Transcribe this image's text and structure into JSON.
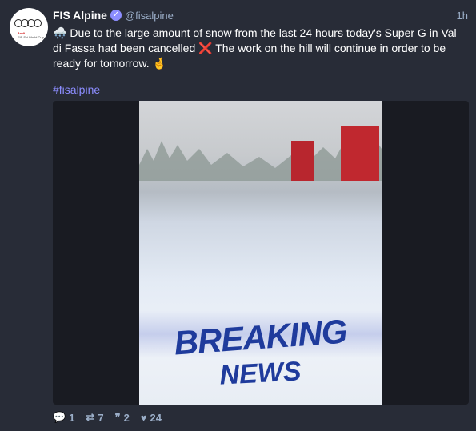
{
  "status": {
    "display_name": "FIS Alpine",
    "handle": "@fisalpine",
    "relative_time": "1h",
    "verified": true,
    "avatar": {
      "brand_line1": "Audi",
      "brand_line2": "FIS Ski World Cup"
    },
    "content_parts": {
      "lead_emoji": "🌨️",
      "text_a": "Due to the large amount of snow from the last 24 hours today's Super G in Val di Fassa had been cancelled",
      "cross_emoji": "❌",
      "text_b": "The work on the hill will continue in order to be ready for tomorrow.",
      "fingers_emoji": "🤞"
    },
    "hashtag": "#fisalpine",
    "media": {
      "overlay_line1": "BREAKING",
      "overlay_line2": "NEWS"
    },
    "actions": {
      "replies": "1",
      "boosts": "7",
      "quotes": "2",
      "favourites": "24"
    }
  },
  "colors": {
    "background": "#282c37",
    "accent": "#8c8dff",
    "muted": "#9baec8",
    "cross": "#df405a",
    "overlay_text": "#1f3b9c"
  },
  "icons": {
    "reply": "reply-icon",
    "boost": "boost-icon",
    "quote": "quote-icon",
    "favourite": "heart-icon",
    "verified": "verified-badge-icon"
  }
}
